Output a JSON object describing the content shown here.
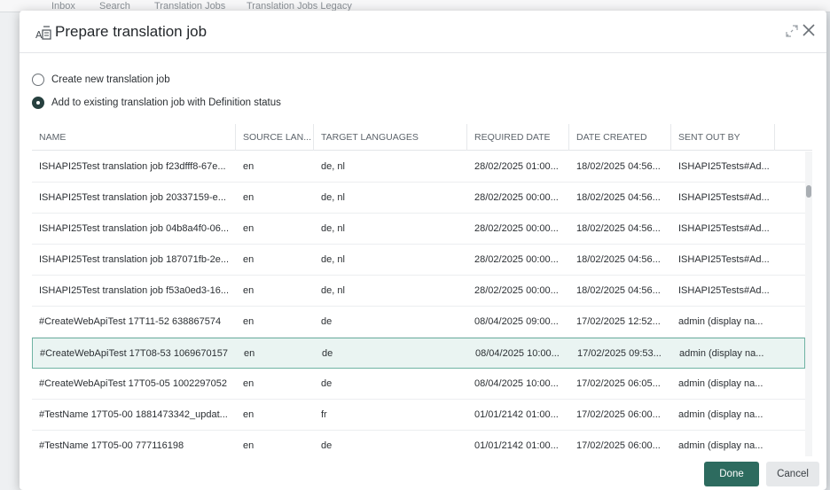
{
  "background": {
    "tabs": [
      "Inbox",
      "Search",
      "Translation Jobs",
      "Translation Jobs Legacy"
    ]
  },
  "dialog": {
    "title": "Prepare translation job",
    "options": [
      {
        "label": "Create new translation job",
        "checked": false
      },
      {
        "label": "Add to existing translation job with Definition status",
        "checked": true
      }
    ],
    "table": {
      "columns": [
        "NAME",
        "SOURCE LAN...",
        "TARGET LANGUAGES",
        "REQUIRED DATE",
        "DATE CREATED",
        "SENT OUT BY"
      ],
      "rows": [
        [
          "ISHAPI25Test translation job f23dfff8-67e...",
          "en",
          "de, nl",
          "28/02/2025 01:00...",
          "18/02/2025 04:56...",
          "ISHAPI25Tests#Ad..."
        ],
        [
          "ISHAPI25Test translation job 20337159-e...",
          "en",
          "de, nl",
          "28/02/2025 00:00...",
          "18/02/2025 04:56...",
          "ISHAPI25Tests#Ad..."
        ],
        [
          "ISHAPI25Test translation job 04b8a4f0-06...",
          "en",
          "de, nl",
          "28/02/2025 00:00...",
          "18/02/2025 04:56...",
          "ISHAPI25Tests#Ad..."
        ],
        [
          "ISHAPI25Test translation job 187071fb-2e...",
          "en",
          "de, nl",
          "28/02/2025 00:00...",
          "18/02/2025 04:56...",
          "ISHAPI25Tests#Ad..."
        ],
        [
          "ISHAPI25Test translation job f53a0ed3-16...",
          "en",
          "de, nl",
          "28/02/2025 00:00...",
          "18/02/2025 04:56...",
          "ISHAPI25Tests#Ad..."
        ],
        [
          "#CreateWebApiTest 17T11-52 638867574",
          "en",
          "de",
          "08/04/2025 09:00...",
          "17/02/2025 12:52...",
          "admin (display na..."
        ],
        [
          "#CreateWebApiTest 17T08-53 1069670157",
          "en",
          "de",
          "08/04/2025 10:00...",
          "17/02/2025 09:53...",
          "admin (display na..."
        ],
        [
          "#CreateWebApiTest 17T05-05 1002297052",
          "en",
          "de",
          "08/04/2025 10:00...",
          "17/02/2025 06:05...",
          "admin (display na..."
        ],
        [
          "#TestName 17T05-00 1881473342_updat...",
          "en",
          "fr",
          "01/01/2142 01:00...",
          "17/02/2025 06:00...",
          "admin (display na..."
        ],
        [
          "#TestName 17T05-00 777116198",
          "en",
          "de",
          "01/01/2142 01:00...",
          "17/02/2025 06:00...",
          "admin (display na..."
        ]
      ],
      "selected_index": 6
    },
    "buttons": {
      "done": "Done",
      "cancel": "Cancel"
    },
    "colors": {
      "primary": "#2d6b5f",
      "selected_row_bg": "#eaf4f2",
      "selected_row_border": "#6fb3a3"
    },
    "icons": [
      "translate-icon",
      "expand-icon",
      "close-icon"
    ]
  }
}
